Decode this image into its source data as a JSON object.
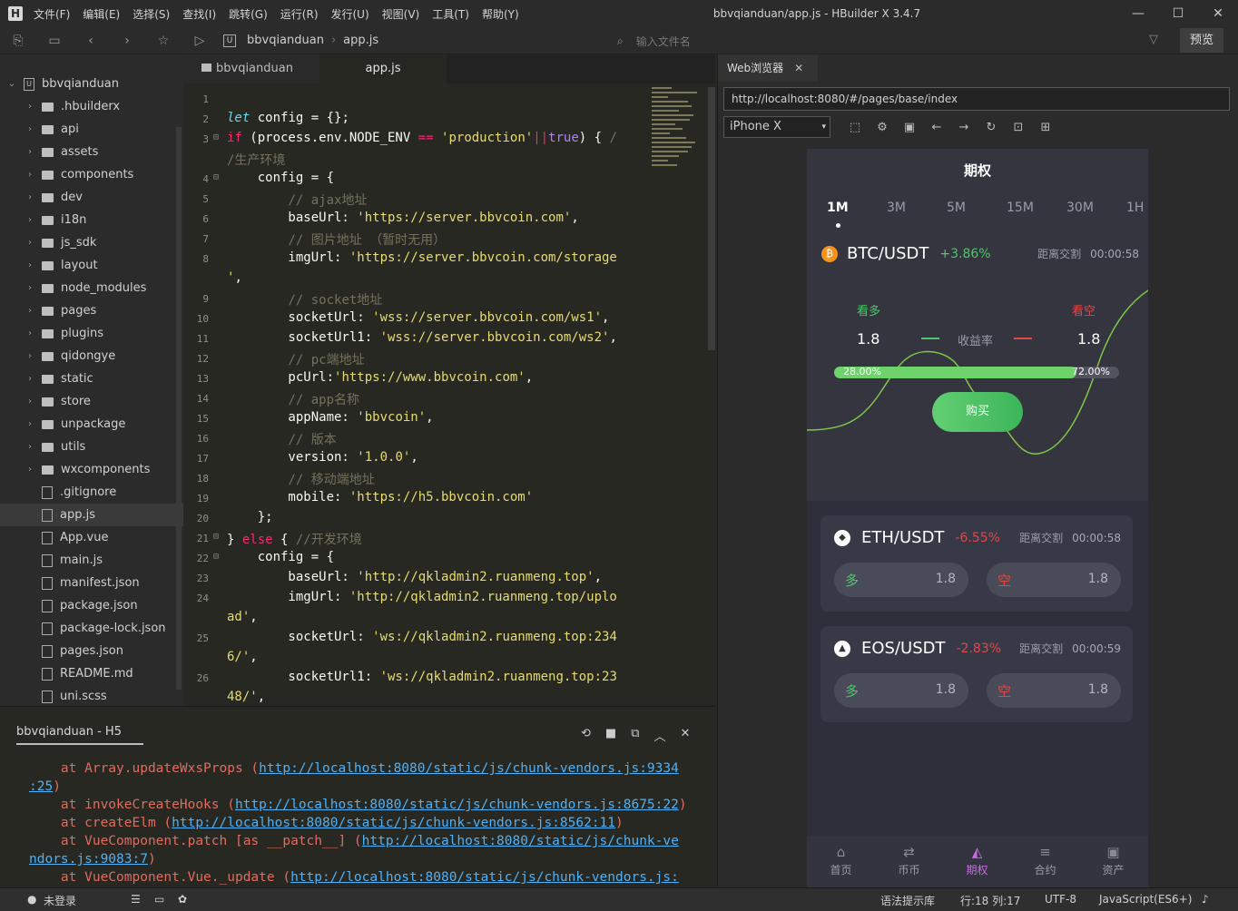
{
  "app": {
    "title": "bbvqianduan/app.js - HBuilder X 3.4.7",
    "logo": "H",
    "menu": [
      "文件(F)",
      "编辑(E)",
      "选择(S)",
      "查找(I)",
      "跳转(G)",
      "运行(R)",
      "发行(U)",
      "视图(V)",
      "工具(T)",
      "帮助(Y)"
    ]
  },
  "toolbar": {
    "breadcrumb": [
      "bbvqianduan",
      "app.js"
    ],
    "file_search_placeholder": "输入文件名",
    "preview_label": "预览"
  },
  "sidebar": {
    "root": "bbvqianduan",
    "items": [
      {
        "label": ".hbuilderx",
        "type": "folder"
      },
      {
        "label": "api",
        "type": "folder"
      },
      {
        "label": "assets",
        "type": "folder"
      },
      {
        "label": "components",
        "type": "folder"
      },
      {
        "label": "dev",
        "type": "folder"
      },
      {
        "label": "i18n",
        "type": "folder"
      },
      {
        "label": "js_sdk",
        "type": "folder"
      },
      {
        "label": "layout",
        "type": "folder"
      },
      {
        "label": "node_modules",
        "type": "folder"
      },
      {
        "label": "pages",
        "type": "folder"
      },
      {
        "label": "plugins",
        "type": "folder"
      },
      {
        "label": "qidongye",
        "type": "folder"
      },
      {
        "label": "static",
        "type": "folder"
      },
      {
        "label": "store",
        "type": "folder"
      },
      {
        "label": "unpackage",
        "type": "folder"
      },
      {
        "label": "utils",
        "type": "folder"
      },
      {
        "label": "wxcomponents",
        "type": "folder"
      },
      {
        "label": ".gitignore",
        "type": "file",
        "icon": "file-icon"
      },
      {
        "label": "app.js",
        "type": "file",
        "icon": "js-file-icon",
        "selected": true
      },
      {
        "label": "App.vue",
        "type": "file",
        "icon": "vue-file-icon"
      },
      {
        "label": "main.js",
        "type": "file",
        "icon": "js-file-icon"
      },
      {
        "label": "manifest.json",
        "type": "file",
        "icon": "manifest-icon"
      },
      {
        "label": "package.json",
        "type": "file",
        "icon": "json-file-icon"
      },
      {
        "label": "package-lock.json",
        "type": "file",
        "icon": "json-file-icon"
      },
      {
        "label": "pages.json",
        "type": "file",
        "icon": "json-file-icon"
      },
      {
        "label": "README.md",
        "type": "file",
        "icon": "markdown-icon"
      },
      {
        "label": "uni.scss",
        "type": "file",
        "icon": "scss-file-icon"
      }
    ]
  },
  "editor": {
    "tabs": [
      "bbvqianduan",
      "app.js"
    ],
    "active_tab": "app.js",
    "lines": [
      {
        "n": "1",
        "fold": "",
        "html": ""
      },
      {
        "n": "2",
        "fold": "",
        "html": "<span class=\"it\">let</span> config = {};"
      },
      {
        "n": "3",
        "fold": "⊟",
        "html": "<span class=\"kw\">if</span> (process.env.NODE_ENV <span class=\"kw\">==</span> <span class=\"st\">'production'</span><span class=\"kw\">||</span><span class=\"bl\">true</span>) { <span class=\"cm\">/</span>"
      },
      {
        "n": "",
        "fold": "",
        "html": "<span class=\"cm\">/生产环境</span>"
      },
      {
        "n": "4",
        "fold": "⊟",
        "html": "    config = {"
      },
      {
        "n": "5",
        "fold": "",
        "html": "        <span class=\"cm\">// ajax地址</span>"
      },
      {
        "n": "6",
        "fold": "",
        "html": "        baseUrl: <span class=\"st\">'https://server.bbvcoin.com'</span>,"
      },
      {
        "n": "7",
        "fold": "",
        "html": "        <span class=\"cm\">// 图片地址 （暂时无用）</span>"
      },
      {
        "n": "8",
        "fold": "",
        "html": "        imgUrl: <span class=\"st\">'https://server.bbvcoin.com/storage</span>"
      },
      {
        "n": "",
        "fold": "",
        "html": "<span class=\"st\">'</span>,"
      },
      {
        "n": "9",
        "fold": "",
        "html": "        <span class=\"cm\">// socket地址</span>"
      },
      {
        "n": "10",
        "fold": "",
        "html": "        socketUrl: <span class=\"st\">'wss://server.bbvcoin.com/ws1'</span>,"
      },
      {
        "n": "11",
        "fold": "",
        "html": "        socketUrl1: <span class=\"st\">'wss://server.bbvcoin.com/ws2'</span>,"
      },
      {
        "n": "12",
        "fold": "",
        "html": "        <span class=\"cm\">// pc端地址</span>"
      },
      {
        "n": "13",
        "fold": "",
        "html": "        pcUrl:<span class=\"st\">'https://www.bbvcoin.com'</span>,"
      },
      {
        "n": "14",
        "fold": "",
        "html": "        <span class=\"cm\">// app名称</span>"
      },
      {
        "n": "15",
        "fold": "",
        "html": "        appName: <span class=\"st\">'bbvcoin'</span>,"
      },
      {
        "n": "16",
        "fold": "",
        "html": "        <span class=\"cm\">// 版本</span>"
      },
      {
        "n": "17",
        "fold": "",
        "html": "        version: <span class=\"st\">'1.0.0'</span>,"
      },
      {
        "n": "18",
        "fold": "",
        "html": "        <span class=\"cm\">// 移动端地址</span>"
      },
      {
        "n": "19",
        "fold": "",
        "html": "        mobile: <span class=\"st\">'https://h5.bbvcoin.com'</span>"
      },
      {
        "n": "20",
        "fold": "",
        "html": "    };"
      },
      {
        "n": "21",
        "fold": "⊟",
        "html": "} <span class=\"kw\">else</span> { <span class=\"cm\">//开发环境</span>"
      },
      {
        "n": "22",
        "fold": "⊟",
        "html": "    config = {"
      },
      {
        "n": "23",
        "fold": "",
        "html": "        baseUrl: <span class=\"st\">'http://qkladmin2.ruanmeng.top'</span>,"
      },
      {
        "n": "24",
        "fold": "",
        "html": "        imgUrl: <span class=\"st\">'http://qkladmin2.ruanmeng.top/uplo</span>"
      },
      {
        "n": "",
        "fold": "",
        "html": "<span class=\"st\">ad'</span>,"
      },
      {
        "n": "25",
        "fold": "",
        "html": "        socketUrl: <span class=\"st\">'ws://qkladmin2.ruanmeng.top:234</span>"
      },
      {
        "n": "",
        "fold": "",
        "html": "<span class=\"st\">6/'</span>,"
      },
      {
        "n": "26",
        "fold": "",
        "html": "        socketUrl1: <span class=\"st\">'ws://qkladmin2.ruanmeng.top:23</span>"
      },
      {
        "n": "",
        "fold": "",
        "html": "<span class=\"st\">48/'</span>,"
      }
    ]
  },
  "console": {
    "tab_label": "bbvqianduan - H5",
    "lines": [
      {
        "pre": "    at Array.updateWxsProps (",
        "link": "http://localhost:8080/static/js/chunk-vendors.js:9334",
        "post": ""
      },
      {
        "pre": "",
        "link": ":25",
        "post": ")"
      },
      {
        "pre": "    at invokeCreateHooks (",
        "link": "http://localhost:8080/static/js/chunk-vendors.js:8675:22",
        "post": ")"
      },
      {
        "pre": "    at createElm (",
        "link": "http://localhost:8080/static/js/chunk-vendors.js:8562:11",
        "post": ")"
      },
      {
        "pre": "    at VueComponent.patch [as __patch__] (",
        "link": "http://localhost:8080/static/js/chunk-ve",
        "post": ""
      },
      {
        "pre": "",
        "link": "ndors.js:9083:7",
        "post": ")"
      },
      {
        "pre": "    at VueComponent.Vue._update (",
        "link": "http://localhost:8080/static/js/chunk-vendors.js:",
        "post": ""
      }
    ]
  },
  "browser": {
    "tab_label": "Web浏览器",
    "url": "http://localhost:8080/#/pages/base/index",
    "device": "iPhone X"
  },
  "phone": {
    "title": "期权",
    "periods": [
      "1M",
      "3M",
      "5M",
      "15M",
      "30M",
      "1H"
    ],
    "active_period": "1M",
    "main": {
      "pair": "BTC/USDT",
      "coin_symbol": "₿",
      "change": "+3.86%",
      "settle_label": "距离交割",
      "countdown": "00:00:58",
      "long_label": "看多",
      "short_label": "看空",
      "long_value": "1.8",
      "short_value": "1.8",
      "rate_label": "收益率",
      "long_pct": "28.00%",
      "short_pct": "72.00%",
      "long_fraction": 0.85,
      "buy_label": "购买"
    },
    "cards": [
      {
        "pair": "ETH/USDT",
        "coin_symbol": "◆",
        "change": "-6.55%",
        "settle_label": "距离交割",
        "countdown": "00:00:58",
        "long_label": "多",
        "long_value": "1.8",
        "short_label": "空",
        "short_value": "1.8"
      },
      {
        "pair": "EOS/USDT",
        "coin_symbol": "▲",
        "change": "-2.83%",
        "settle_label": "距离交割",
        "countdown": "00:00:59",
        "long_label": "多",
        "long_value": "1.8",
        "short_label": "空",
        "short_value": "1.8"
      }
    ],
    "tabbar": [
      {
        "label": "首页",
        "icon": "home-icon",
        "glyph": "⌂"
      },
      {
        "label": "币币",
        "icon": "coin-exchange-icon",
        "glyph": "⇄"
      },
      {
        "label": "期权",
        "icon": "options-icon",
        "glyph": "◭",
        "active": true
      },
      {
        "label": "合约",
        "icon": "contract-icon",
        "glyph": "≡"
      },
      {
        "label": "资产",
        "icon": "wallet-icon",
        "glyph": "▣"
      }
    ]
  },
  "status": {
    "login": "未登录",
    "syntax_lib": "语法提示库",
    "position": "行:18  列:17",
    "encoding": "UTF-8",
    "language": "JavaScript(ES6+)"
  },
  "colors": {
    "accent": "#c86ae4",
    "up": "#4fc66b",
    "down": "#e04848",
    "bg": "#272822"
  }
}
